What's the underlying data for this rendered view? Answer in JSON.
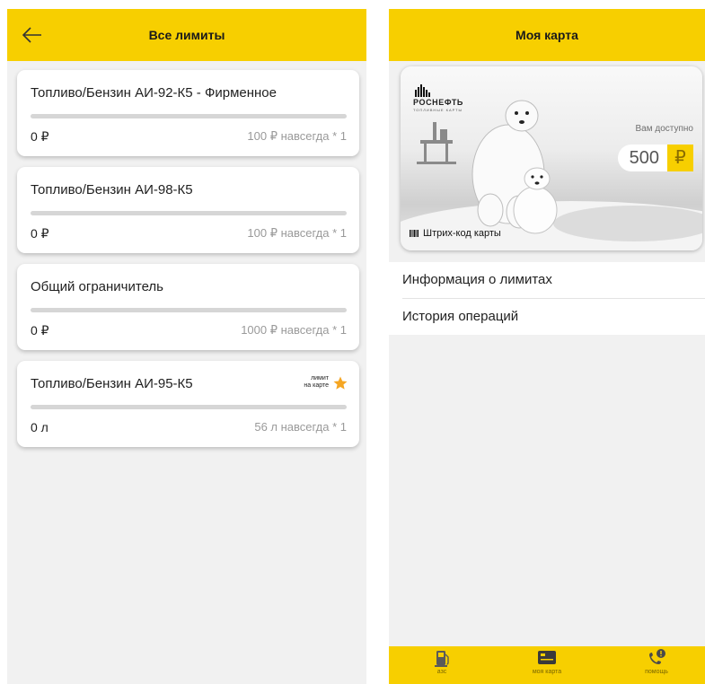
{
  "left_screen": {
    "title": "Все лимиты",
    "limits": [
      {
        "name": "Топливо/Бензин АИ-92-К5 - Фирменное",
        "used": "0 ₽",
        "total": "100 ₽ навсегда * 1"
      },
      {
        "name": "Топливо/Бензин АИ-98-К5",
        "used": "0 ₽",
        "total": "100 ₽ навсегда * 1"
      },
      {
        "name": "Общий ограничитель",
        "used": "0 ₽",
        "total": "1000 ₽ навсегда * 1"
      },
      {
        "name": "Топливо/Бензин АИ-95-К5",
        "used": "0 л",
        "total": "56 л навсегда * 1",
        "badge_line1": "лимит",
        "badge_line2": "на карте"
      }
    ]
  },
  "right_screen": {
    "title": "Моя карта",
    "card": {
      "brand_name": "РОСНЕФТЬ",
      "brand_sub": "ТОПЛИВНЫЕ КАРТЫ",
      "available_label": "Вам доступно",
      "amount": "500",
      "currency": "₽",
      "barcode_label": "Штрих-код карты"
    },
    "menu": [
      {
        "label": "Информация о лимитах"
      },
      {
        "label": "История операций"
      }
    ],
    "bottom_nav": [
      {
        "label": "азс",
        "icon": "fuel-pump-icon"
      },
      {
        "label": "моя карта",
        "icon": "card-icon"
      },
      {
        "label": "помощь",
        "icon": "phone-help-icon"
      }
    ]
  },
  "colors": {
    "accent": "#f7cf00",
    "background": "#f1f1f1",
    "star": "#f5a623"
  }
}
